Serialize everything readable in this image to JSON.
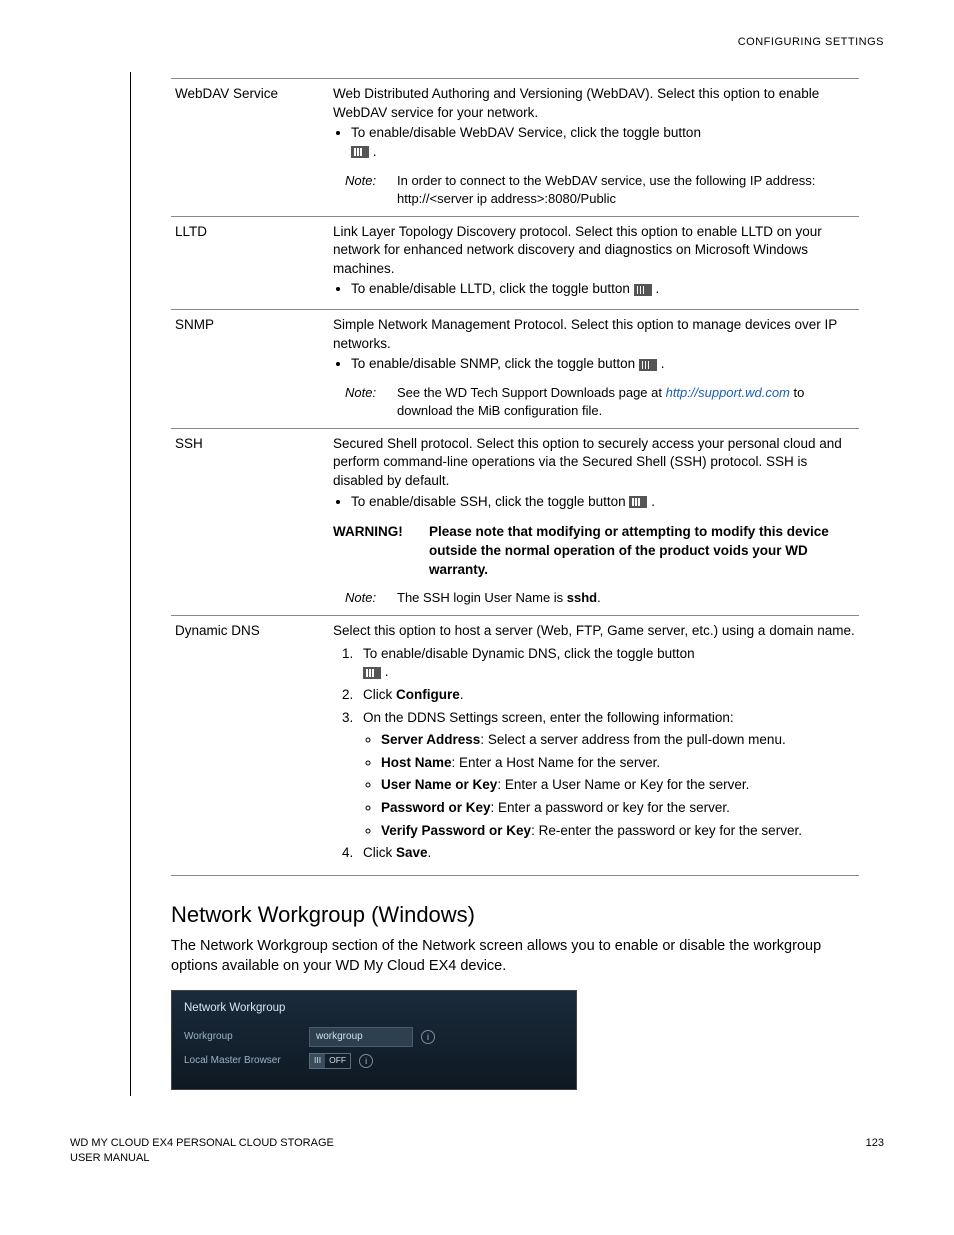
{
  "header": {
    "right": "CONFIGURING SETTINGS"
  },
  "rows": {
    "webdav": {
      "label": "WebDAV Service",
      "desc": "Web Distributed Authoring and Versioning (WebDAV). Select this option to enable WebDAV service for your network.",
      "bullet1": "To enable/disable WebDAV Service, click the toggle button ",
      "note_label": "Note:",
      "note": "In order to connect to the WebDAV service, use the following IP address: http://<server ip address>:8080/Public"
    },
    "lltd": {
      "label": "LLTD",
      "desc": "Link Layer Topology Discovery protocol. Select this option to enable LLTD on your network for enhanced network discovery and diagnostics on Microsoft Windows machines.",
      "bullet1": "To enable/disable LLTD, click the toggle button "
    },
    "snmp": {
      "label": "SNMP",
      "desc": "Simple Network Management Protocol. Select this option to manage devices over IP networks.",
      "bullet1": "To enable/disable SNMP, click the toggle button ",
      "note_label": "Note:",
      "note_pre": "See the WD Tech Support Downloads page at ",
      "note_link": "http://support.wd.com",
      "note_post": " to download the MiB configuration file."
    },
    "ssh": {
      "label": "SSH",
      "desc": "Secured Shell protocol. Select this option to securely access your personal cloud and perform command-line operations via the Secured Shell (SSH) protocol. SSH is disabled by default.",
      "bullet1": "To enable/disable SSH, click the toggle button ",
      "warn_label": "WARNING!",
      "warn": "Please note that modifying or attempting to modify this device outside the normal operation of the product voids your WD warranty.",
      "note_label": "Note:",
      "note_pre": "The SSH login User Name is ",
      "note_bold": "sshd",
      "note_post": "."
    },
    "ddns": {
      "label": "Dynamic DNS",
      "desc": "Select this option to host a server (Web, FTP, Game server, etc.) using a domain name.",
      "step1": "To enable/disable Dynamic DNS, click the toggle button ",
      "step2_pre": "Click ",
      "step2_bold": "Configure",
      "step2_post": ".",
      "step3": "On the DDNS Settings screen, enter the following information:",
      "s3b1_bold": "Server Address",
      "s3b1_rest": ": Select a server address from the pull-down menu.",
      "s3b2_bold": "Host Name",
      "s3b2_rest": ": Enter a Host Name for the server.",
      "s3b3_bold": "User Name or Key",
      "s3b3_rest": ": Enter a User Name or Key for the server.",
      "s3b4_bold": "Password or Key",
      "s3b4_rest": ": Enter a password or key for the server.",
      "s3b5_bold": "Verify Password or Key",
      "s3b5_rest": ": Re-enter the password or key for the server.",
      "step4_pre": "Click ",
      "step4_bold": "Save",
      "step4_post": "."
    }
  },
  "section": {
    "title": "Network Workgroup (Windows)",
    "para": "The Network Workgroup section of the Network screen allows you to enable or disable the workgroup options available on your WD My Cloud EX4 device."
  },
  "ui": {
    "title": "Network Workgroup",
    "row1_label": "Workgroup",
    "row1_value": "workgroup",
    "row2_label": "Local Master Browser",
    "toggle_on": "III",
    "toggle_off": "OFF"
  },
  "footer": {
    "left1": "WD MY CLOUD EX4 PERSONAL CLOUD STORAGE",
    "left2": "USER MANUAL",
    "page": "123"
  }
}
